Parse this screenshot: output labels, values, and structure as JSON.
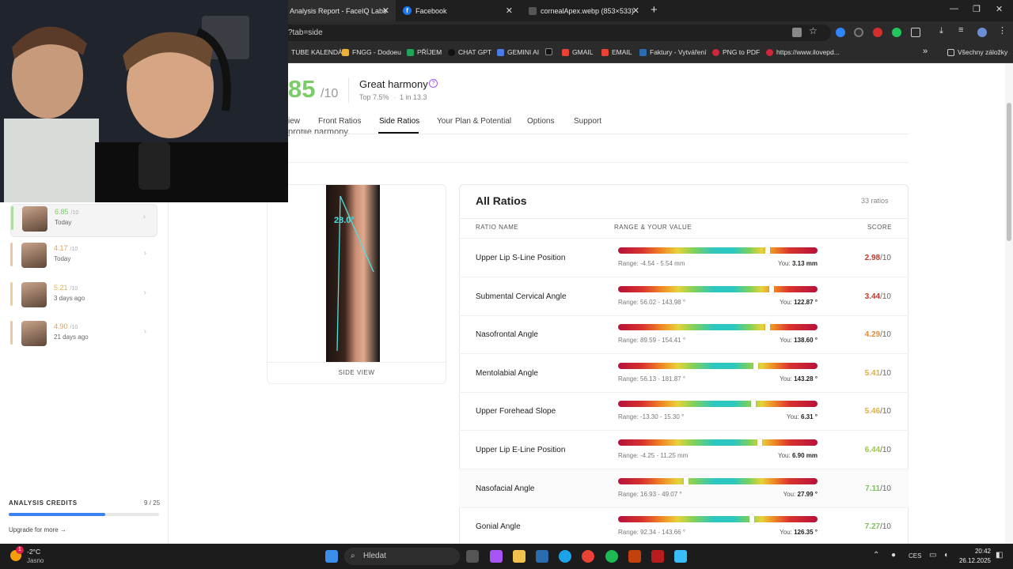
{
  "browser": {
    "tabs": [
      {
        "title": "Analysis Report - FaceIQ Labs",
        "active": true
      },
      {
        "title": "Facebook",
        "active": false
      },
      {
        "title": "cornealApex.webp (853×533)",
        "active": false
      }
    ],
    "new_tab": "+",
    "url": "?tab=side",
    "bookmarks": [
      "TUBE KALENDÁŘ",
      "FNGG - Dodoeu",
      "PŘÍJEM",
      "CHAT GPT",
      "GEMINI AI",
      "",
      "GMAIL",
      "EMAIL",
      "Faktury - Vytváření",
      "PNG to PDF",
      "https://www.ilovepd..."
    ],
    "bookmarks_overflow": "»",
    "all_bookmarks": "Všechny záložky"
  },
  "header": {
    "score_partial": "85",
    "score_den": "/10",
    "harmony": "Great harmony",
    "top": "Top 7.5%",
    "one_in": "1 in 13.3",
    "tabs": [
      "iew",
      "Front Ratios",
      "Side Ratios",
      "Your Plan & Potential",
      "Options",
      "Support"
    ],
    "partial_text": "profile harmony."
  },
  "sidebar": {
    "history": [
      {
        "score": "6.85",
        "den": "/10",
        "date": "Today",
        "color": "#7ccc6a"
      },
      {
        "score": "4.17",
        "den": "/10",
        "date": "Today",
        "color": "#e0a060"
      },
      {
        "score": "5.21",
        "den": "/10",
        "date": "3 days ago",
        "color": "#e0b050"
      },
      {
        "score": "4.90",
        "den": "/10",
        "date": "21 days ago",
        "color": "#e0a060"
      }
    ],
    "credits_label": "ANALYSIS CREDITS",
    "credits_count": "9 / 25",
    "credits_fraction": 0.64,
    "upgrade": "Upgrade for more →"
  },
  "side_image": {
    "angle": "28.0°",
    "caption": "SIDE VIEW"
  },
  "ratios": {
    "title": "All Ratios",
    "count": "33 ratios",
    "col_name": "RATIO NAME",
    "col_range": "RANGE & YOUR VALUE",
    "col_score": "SCORE",
    "rows": [
      {
        "name": "Upper Lip S-Line Position",
        "range": "Range: -4.54 - 5.54 mm",
        "you_label": "You:",
        "you": "3.13 mm",
        "score": "2.98",
        "den": "/10",
        "color": "#c0392b",
        "pos": 0.75
      },
      {
        "name": "Submental Cervical Angle",
        "range": "Range: 56.02 - 143.98 °",
        "you_label": "You:",
        "you": "122.87 °",
        "score": "3.44",
        "den": "/10",
        "color": "#c0392b",
        "pos": 0.77
      },
      {
        "name": "Nasofrontal Angle",
        "range": "Range: 89.59 - 154.41 °",
        "you_label": "You:",
        "you": "138.60 °",
        "score": "4.29",
        "den": "/10",
        "color": "#e08a3c",
        "pos": 0.75
      },
      {
        "name": "Mentolabial Angle",
        "range": "Range: 56.13 - 181.87 °",
        "you_label": "You:",
        "you": "143.28 °",
        "score": "5.41",
        "den": "/10",
        "color": "#e0b040",
        "pos": 0.69
      },
      {
        "name": "Upper Forehead Slope",
        "range": "Range: -13.30 - 15.30 °",
        "you_label": "You:",
        "you": "6.31 °",
        "score": "5.46",
        "den": "/10",
        "color": "#e0b040",
        "pos": 0.68
      },
      {
        "name": "Upper Lip E-Line Position",
        "range": "Range: -4.25 - 11.25 mm",
        "you_label": "You:",
        "you": "6.90 mm",
        "score": "6.44",
        "den": "/10",
        "color": "#9cc94c",
        "pos": 0.71
      },
      {
        "name": "Nasofacial Angle",
        "range": "Range: 16.93 - 49.07 °",
        "you_label": "You:",
        "you": "27.99 °",
        "score": "7.11",
        "den": "/10",
        "color": "#7cc45a",
        "pos": 0.34
      },
      {
        "name": "Gonial Angle",
        "range": "Range: 92.34 - 143.66 °",
        "you_label": "You:",
        "you": "126.35 °",
        "score": "7.27",
        "den": "/10",
        "color": "#7cc45a",
        "pos": 0.67
      }
    ]
  },
  "taskbar": {
    "temp": "-2°C",
    "weather": "Jasno",
    "weather_badge": "1",
    "search": "Hledat",
    "lang": "CES",
    "time": "20:42",
    "date": "26.12.2025"
  }
}
